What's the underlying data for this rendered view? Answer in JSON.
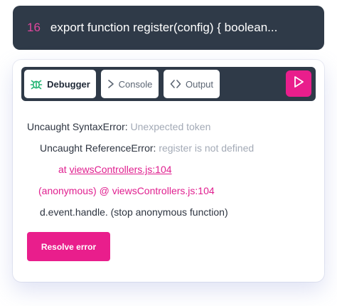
{
  "code": {
    "line_number": "16",
    "text": "export function register(config) { boolean..."
  },
  "toolbar": {
    "tabs": [
      {
        "label": "Debugger",
        "icon": "bug-icon",
        "active": true
      },
      {
        "label": "Console",
        "icon": "chevron-right-icon",
        "active": false
      },
      {
        "label": "Output",
        "icon": "code-brackets-icon",
        "active": false
      }
    ],
    "run_icon": "play-icon"
  },
  "errors": {
    "line1_label": "Uncaught SyntaxError:",
    "line1_detail": "Unexpected token",
    "line2_label": "Uncaught ReferenceError:",
    "line2_detail": "register is not defined",
    "line3_prefix": "at",
    "line3_link": "viewsControllers.js:104",
    "line4": "(anonymous) @ viewsControllers.js:104",
    "line5": "d.event.handle. (stop anonymous function)"
  },
  "actions": {
    "resolve_label": "Resolve error"
  },
  "colors": {
    "accent": "#e91e8c",
    "dark": "#2f3a48",
    "muted_text": "#a3aab6",
    "debug_icon": "#22b573"
  }
}
